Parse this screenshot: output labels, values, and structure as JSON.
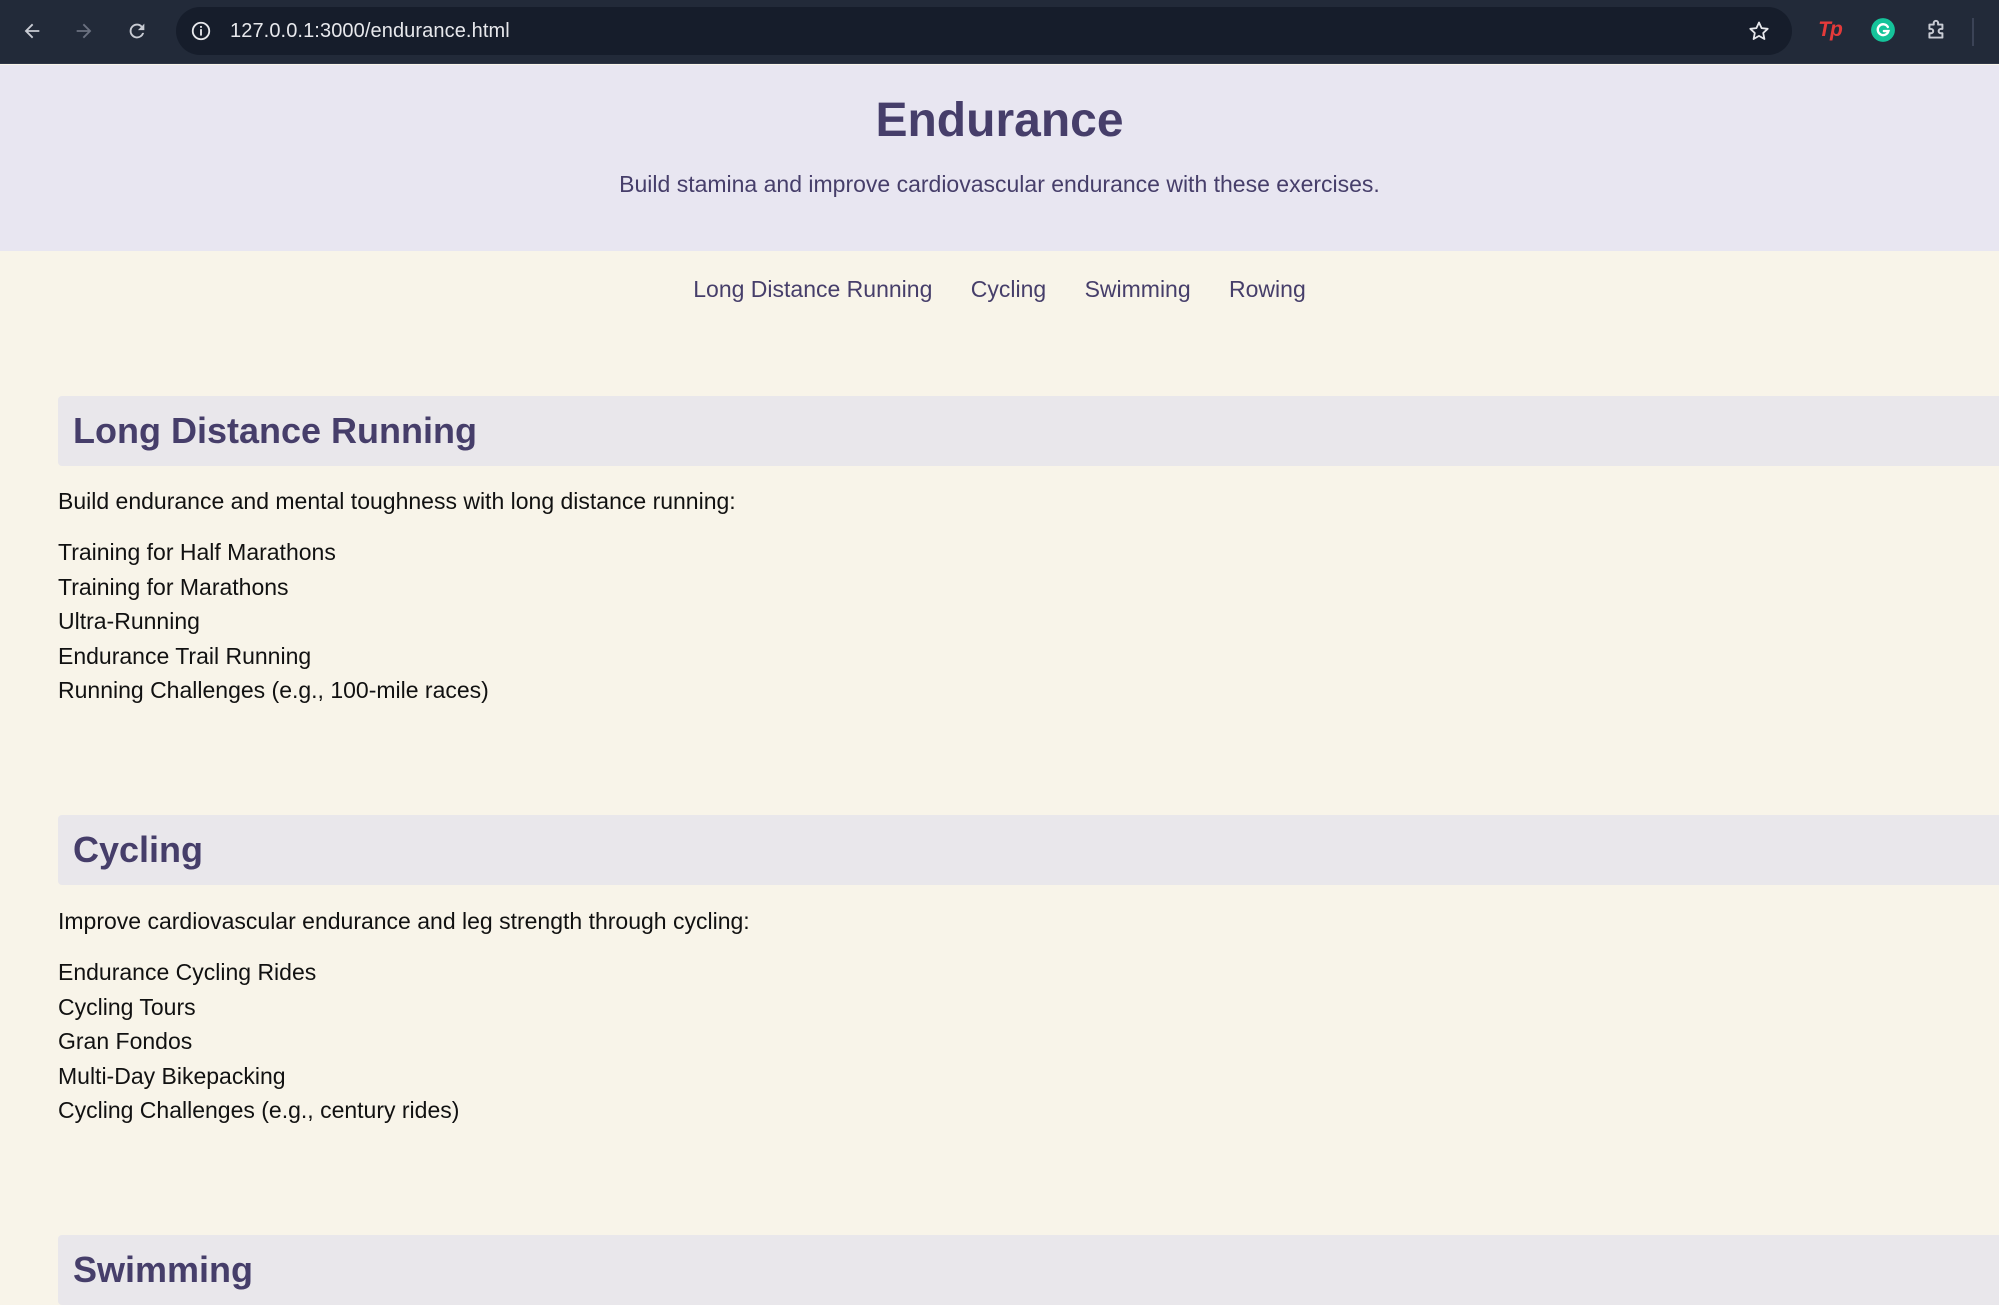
{
  "browser": {
    "url": "127.0.0.1:3000/endurance.html",
    "icons": [
      "back-arrow-icon",
      "forward-arrow-icon",
      "reload-icon",
      "site-info-icon",
      "star-icon",
      "tp-extension-icon",
      "grammarly-icon",
      "extensions-puzzle-icon"
    ]
  },
  "hero": {
    "title": "Endurance",
    "subtitle": "Build stamina and improve cardiovascular endurance with these exercises."
  },
  "nav": [
    "Long Distance Running",
    "Cycling",
    "Swimming",
    "Rowing"
  ],
  "sections": [
    {
      "title": "Long Distance Running",
      "intro": "Build endurance and mental toughness with long distance running:",
      "items": [
        "Training for Half Marathons",
        "Training for Marathons",
        "Ultra-Running",
        "Endurance Trail Running",
        "Running Challenges (e.g., 100-mile races)"
      ]
    },
    {
      "title": "Cycling",
      "intro": "Improve cardiovascular endurance and leg strength through cycling:",
      "items": [
        "Endurance Cycling Rides",
        "Cycling Tours",
        "Gran Fondos",
        "Multi-Day Bikepacking",
        "Cycling Challenges (e.g., century rides)"
      ]
    },
    {
      "title": "Swimming"
    }
  ],
  "colors": {
    "chrome_bg": "#222a39",
    "hero_bg": "#e8e6f1",
    "page_bg": "#f8f4e9",
    "accent_text": "#463e6a",
    "section_head_bg": "#e9e7eb"
  }
}
